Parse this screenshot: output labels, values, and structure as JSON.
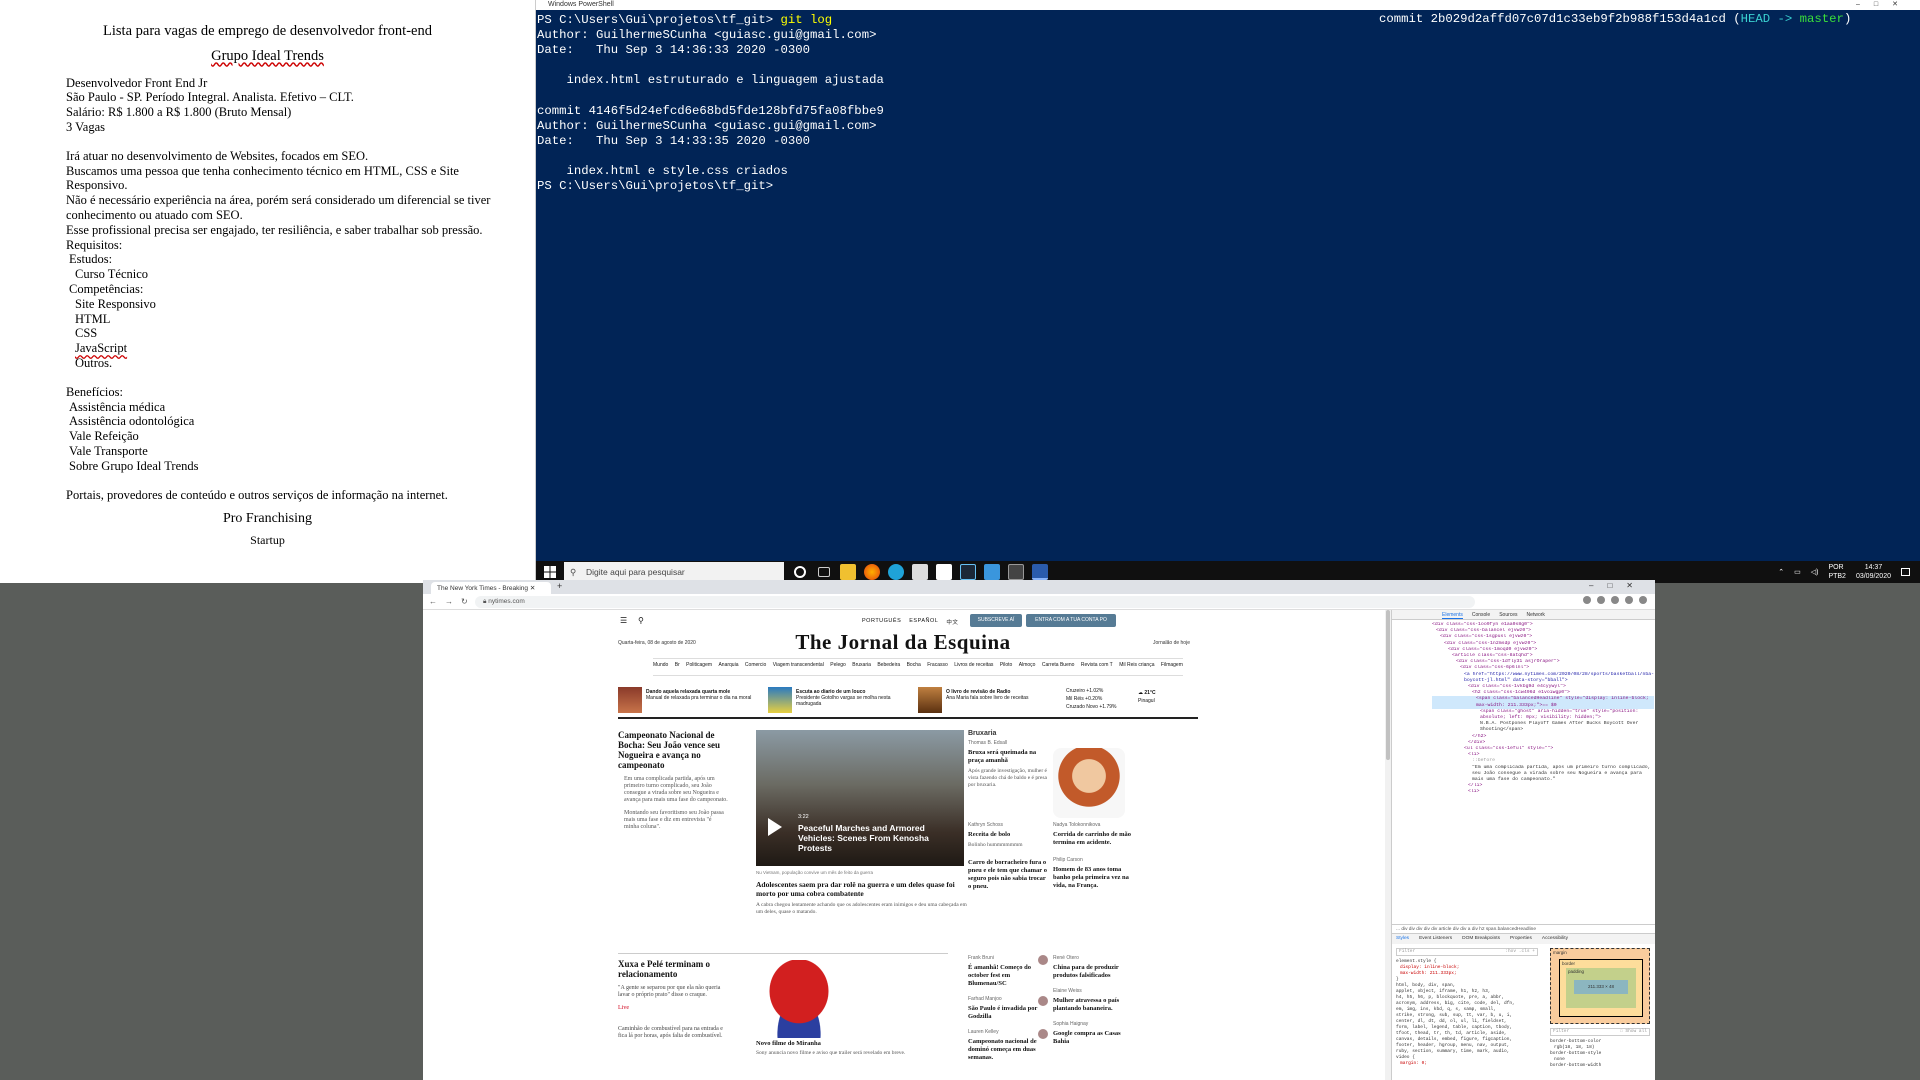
{
  "document": {
    "title": "Lista para vagas de emprego de desenvolvedor front-end",
    "company": "Grupo Ideal Trends",
    "lines_block1": [
      "Desenvolvedor Front End Jr",
      "São Paulo - SP. Período Integral. Analista. Efetivo – CLT.",
      "Salário: R$ 1.800 a R$ 1.800 (Bruto Mensal)",
      "3 Vagas"
    ],
    "lines_block2": [
      "Irá atuar no desenvolvimento de Websites, focados em SEO.",
      "Buscamos uma pessoa que tenha conhecimento técnico em HTML, CSS e Site Responsivo.",
      "Não é necessário experiência na área, porém será considerado um diferencial se tiver conhecimento ou atuado com SEO.",
      "Esse profissional precisa ser engajado, ter resiliência, e saber trabalhar sob pressão."
    ],
    "requisitos": "Requisitos:",
    "estudos": "Estudos:",
    "estudos_items": [
      "Curso Técnico"
    ],
    "competencias": "Competências:",
    "competencias_items": [
      "Site Responsivo",
      "HTML",
      "CSS",
      "JavaScript",
      "Outros."
    ],
    "beneficios": "Benefícios:",
    "beneficios_items": [
      "Assistência médica",
      "Assistência odontológica",
      "Vale Refeição",
      "Vale Transporte",
      "Sobre Grupo Ideal Trends"
    ],
    "portais": "Portais, provedores de conteúdo e outros serviços de informação na internet.",
    "franchising": "Pro Franchising",
    "startup": "Startup"
  },
  "powershell": {
    "window_title": "Windows PowerShell",
    "prompt1": "PS C:\\Users\\Gui\\projetos\\tf_git>",
    "command": "git log",
    "commit1_hash_line": "commit 2b029d2affd07c07d1c33eb9f2b988f153d4a1cd",
    "head": "HEAD -> master",
    "author1": "Author: GuilhermeSCunha <guiasc.gui@gmail.com>",
    "date1": "Date:   Thu Sep 3 14:36:33 2020 -0300",
    "msg1": "    index.html estruturado e linguagem ajustada",
    "commit2": "commit 4146f5d24efcd6e68bd5fde128bfd75fa08fbbe9",
    "author2": "Author: GuilhermeSCunha <guiasc.gui@gmail.com>",
    "date2": "Date:   Thu Sep 3 14:33:35 2020 -0300",
    "msg2": "    index.html e style.css criados",
    "prompt2": "PS C:\\Users\\Gui\\projetos\\tf_git>"
  },
  "taskbar": {
    "search_placeholder": "Digite aqui para pesquisar",
    "lang": "POR",
    "layout": "PTB2",
    "time": "14:37",
    "date": "03/09/2020"
  },
  "browser": {
    "tab_title": "The New York Times - Breaking",
    "url": "nytimes.com",
    "page": {
      "langs": [
        "PORTUGUÊS",
        "ESPAÑOL",
        "中文"
      ],
      "subscribe": "SUBSCREVE AÍ",
      "login_btn": "ENTRA COM A TUA CONTA PO",
      "date": "Quarta-feira, 08 de agosto de 2020",
      "login_link": "Jornalão de hoje",
      "masthead": "The Jornal da Esquina",
      "sections": [
        "Mundo",
        "Br",
        "Politicagem",
        "Anarquia",
        "Comercio",
        "Viagem transcendental",
        "Pelego",
        "Bruxaria",
        "Bebedeira",
        "Bocha",
        "Fracasso",
        "Livros de receitas",
        "Piloto",
        "Almoço",
        "Carreta Bueno",
        "Revista com T",
        "Mil Reis criança",
        "Filmagem"
      ],
      "strip": [
        {
          "title": "Dando aquela relaxada quarta mole",
          "sub": "Manual de relaxada pra terminar o dia na moral"
        },
        {
          "title": "Escuta ao diario de um louco",
          "sub": "Presidente Gotolho vargas se molha nesta madrugada"
        },
        {
          "title": "O livro de revisão de Radio",
          "sub": "Ana Maria fala sobre livro de receitas"
        }
      ],
      "markets": [
        "Cruzeiro  +1.02%",
        "Mil Réis  +0.20%",
        "Cruzado Novo +1.79%"
      ],
      "weather": "21°C",
      "weather_place": "Pinagul",
      "lead_h": "Campeonato Nacional de Bocha: Seu João vence seu Nogueira e avança no campeonato",
      "lead_s": "Em uma complicada partida, após um primeiro turno complicado, seu João consegue a virada sobre seu Nogueira e avança para mais uma fase do campeonato.",
      "lead_b": "Montando seu favoritismo seu João passa mais uma fase e diz em entrevista \"é minha coluna\".",
      "video_dur": "3:22",
      "video_title": "Peaceful Marches and Armored Vehicles: Scenes From Kenosha Protests",
      "video_cap": "Nu Vietnam, população convive um mês de feito da guerra",
      "main_h": "Adolescentes saem pra dar rolê na guerra e um deles quase foi morto por uma cobra combatente",
      "main_s": "A cabra chegou lentamente achando que os adolescentes eram inimigos e deu uma cabeçada em um deles, quase o matando.",
      "brux_kicker": "Bruxaria",
      "brux_author": "Thomas B. Edsall",
      "brux_h": "Bruxa será queimada na praça amanhã",
      "brux_s": "Após grande investigação, mulher é vista fazendo chá de baldo e é presa por bruxaria.",
      "op1_author": "Kathryn Schoss",
      "op1_h": "Receita de bolo",
      "op1_s": "Bolinho hummmmmmm",
      "op2_author": "Nadya Tolokonnikova",
      "op2_h": "Corrida de carrinho de mão termina em acidente.",
      "op3_h": "Carro de borracheiro fura o pneu e ele tem que chamar o seguro pois não sabia trocar o pneu.",
      "op4_author": "Philip Carson",
      "op4_h": "Homem de 83 anos toma banho pela primeira vez na vida, na França.",
      "sec2_h": "Xuxa e Pelé terminam o relacionamento",
      "sec2_s": "\"A gente se separou por que ela não queria lavar o próprio prato\" disse o craque.",
      "sec2_live": "Live",
      "sec2_b": "Caminhão de combustível para na entrada e fica lá por horas, após falta de combustível.",
      "film_h": "Novo filme do Miranha",
      "film_s": "Sony anuncia novo filme e aviso que trailer será revelado em breve.",
      "r1_author": "Frank Bruni",
      "r1_h": "É amanhã! Começo do october fest em Blumenau/SC",
      "r2_author": "René Otero",
      "r2_h": "China para de produzir produtos falsificados",
      "r3_author": "Farhad Manjoo",
      "r3_h": "São Paulo é invadida por Godzilla",
      "r4_author": "Elaine Weiss",
      "r4_h": "Mulher atravessa o país plantando bananeira.",
      "r5_author": "Lauren Kelley",
      "r5_h": "Campeonato nacional de dominó começa em duas semanas.",
      "r6_author": "Sophia Haignay",
      "r6_h": "Google compra as Casas Bahia"
    }
  },
  "devtools": {
    "tabs": [
      "Elements",
      "Console",
      "Sources",
      "Network"
    ],
    "tree": [
      "<div class=\"css-1oo9fyn e1aa0s8g0\">",
      "<div class=\"css-balancel ejvwz0\">",
      "<div class=\"css-1sgpusl ejvwz0\">",
      "<div class=\"css-1n2msdp ejvwz0\">",
      "<div class=\"css-1moqd0 ejvwz0\">",
      "<article class=\"css-8atqhd\">",
      "<div class=\"css-1dfly31 asjrOraper\">",
      "<div class=\"css-6p6lnl\">",
      "<a href=\"https://www.nytimes.com/2020/08/28/sports/basketball/nba-boycott-jl.html\" data-story=\"bball\">",
      "<div class=\"css-1vkbg9d e4cyywyl\">",
      "<h2 class=\"css-1cw496d e1voiwgp0\">",
      "<span class=\"balancedHeadline\" style=\"display: inline-block; max-width: 211.333px;\">== $0",
      "<span class=\"ghost\" aria-hidden=\"true\" style=\"position: absolute; left: 0px; visibility: hidden;\">",
      "N.B.A. Postpones Playoff Games After Bucks Boycott Over Shooting</span>",
      "</h2>",
      "</div>",
      "<ul class=\"css-1eful\" style=\"\">",
      "<li>",
      "::before",
      "\"Em uma complicada partida, após um primeiro turno complicado, seu João consegue a virada sobre seu Nogueira e avança para mais uma fase do campeonato.\"",
      "</li>",
      "<li>"
    ],
    "breadcrumb": "... div div div div div article div div a div h2 span.balancedHeadline",
    "style_tabs": [
      "Styles",
      "Event Listeners",
      "DOM Breakpoints",
      "Properties",
      "Accessibility"
    ],
    "filter": "Filter",
    "hov": ":hov  .cls  +",
    "styles_lines": [
      "element.style {",
      "display: inline-block;",
      "max-width: 211.333px;",
      "}",
      "html, body, div, span,",
      "applet, object, iframe, h1, h2, h3,",
      "h4, h5, h6, p, blockquote, pre, a, abbr,",
      "acronym, address, big, cite, code, del, dfn,",
      "em, img, ins, kbd, q, s, samp, small,",
      "strike, strong, sub, sup, tt, var, b, u, i,",
      "center, dl, dt, dd, ol, ul, li, fieldset,",
      "form, label, legend, table, caption, tbody,",
      "tfoot, thead, tr, th, td, article, aside,",
      "canvas, details, embed, figure, figcaption,",
      "footer, header, hgroup, menu, nav, output,",
      "ruby, section, summary, time, mark, audio,",
      "video {",
      "margin: 0;"
    ],
    "box_labels": [
      "margin",
      "border",
      "padding",
      "211.333 × 48"
    ],
    "computed_filter": "Filter",
    "show_all": "Show all",
    "computed": [
      "border-bottom-color",
      "rgb(18, 18, 18)",
      "border-bottom-style",
      "none",
      "border-bottom-width"
    ]
  }
}
